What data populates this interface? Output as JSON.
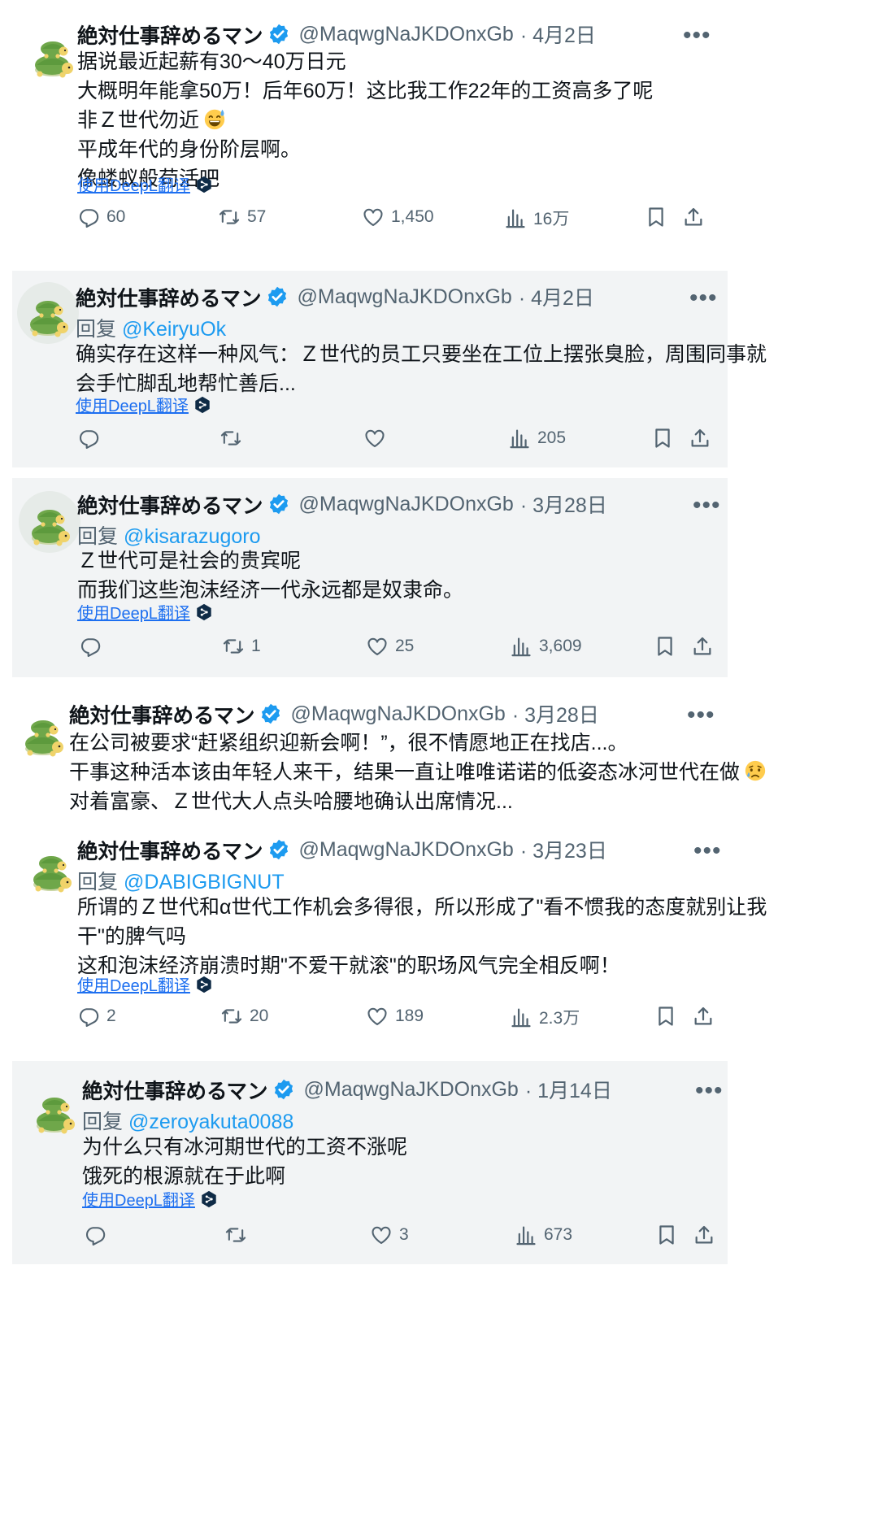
{
  "common": {
    "display_name": "絶対仕事辞めるマン",
    "handle": "@MaqwgNaJKDOnxGb",
    "translate_label": "使用DeepL翻译",
    "more_label": "•••",
    "reply_prefix": "回复"
  },
  "posts": [
    {
      "date": "· 4月2日",
      "lines": [
        "据说最近起薪有30～40万日元",
        "大概明年能拿50万！后年60万！这比我工作22年的工资高多了呢",
        "非Ｚ世代勿近",
        "平成年代的身份阶层啊。",
        "像蝼蚁般苟活吧"
      ],
      "emoji": "sweat-smile",
      "stats": {
        "replies": "60",
        "reposts": "57",
        "likes": "1,450",
        "views": "16万"
      }
    },
    {
      "date": "· 4月2日",
      "reply_to": "@KeiryuOk",
      "lines": [
        "确实存在这样一种风气：Ｚ世代的员工只要坐在工位上摆张臭脸，周围同事就",
        "会手忙脚乱地帮忙善后..."
      ],
      "stats": {
        "replies": "",
        "reposts": "",
        "likes": "",
        "views": "205"
      }
    },
    {
      "date": "· 3月28日",
      "reply_to": "@kisarazugoro",
      "lines": [
        "Ｚ世代可是社会的贵宾呢",
        "而我们这些泡沫经济一代永远都是奴隶命。"
      ],
      "stats": {
        "replies": "",
        "reposts": "1",
        "likes": "25",
        "views": "3,609"
      }
    },
    {
      "date": "· 3月28日",
      "lines": [
        "在公司被要求“赶紧组织迎新会啊！”，很不情愿地正在找店...。",
        "干事这种活本该由年轻人来干，结果一直让唯唯诺诺的低姿态冰河世代在做",
        "对着富豪、Ｚ世代大人点头哈腰地确认出席情况..."
      ],
      "emoji": "crying"
    },
    {
      "date": "· 3月23日",
      "reply_to": "@DABIGBIGNUT",
      "lines": [
        "所谓的Ｚ世代和α世代工作机会多得很，所以形成了\"看不惯我的态度就别让我",
        "干\"的脾气吗",
        "这和泡沫经济崩溃时期\"不爱干就滚\"的职场风气完全相反啊！"
      ],
      "stats": {
        "replies": "2",
        "reposts": "20",
        "likes": "189",
        "views": "2.3万"
      }
    },
    {
      "date": "· 1月14日",
      "reply_to": "@zeroyakuta0088",
      "lines": [
        "为什么只有冰河期世代的工资不涨呢",
        "饿死的根源就在于此啊"
      ],
      "stats": {
        "replies": "",
        "reposts": "",
        "likes": "3",
        "views": "673"
      }
    }
  ],
  "colors": {
    "text": "#0f1419",
    "secondary": "#536471",
    "link": "#1d9bf0",
    "verified": "#1d9bf0",
    "gray_card": "#f2f4f5"
  }
}
